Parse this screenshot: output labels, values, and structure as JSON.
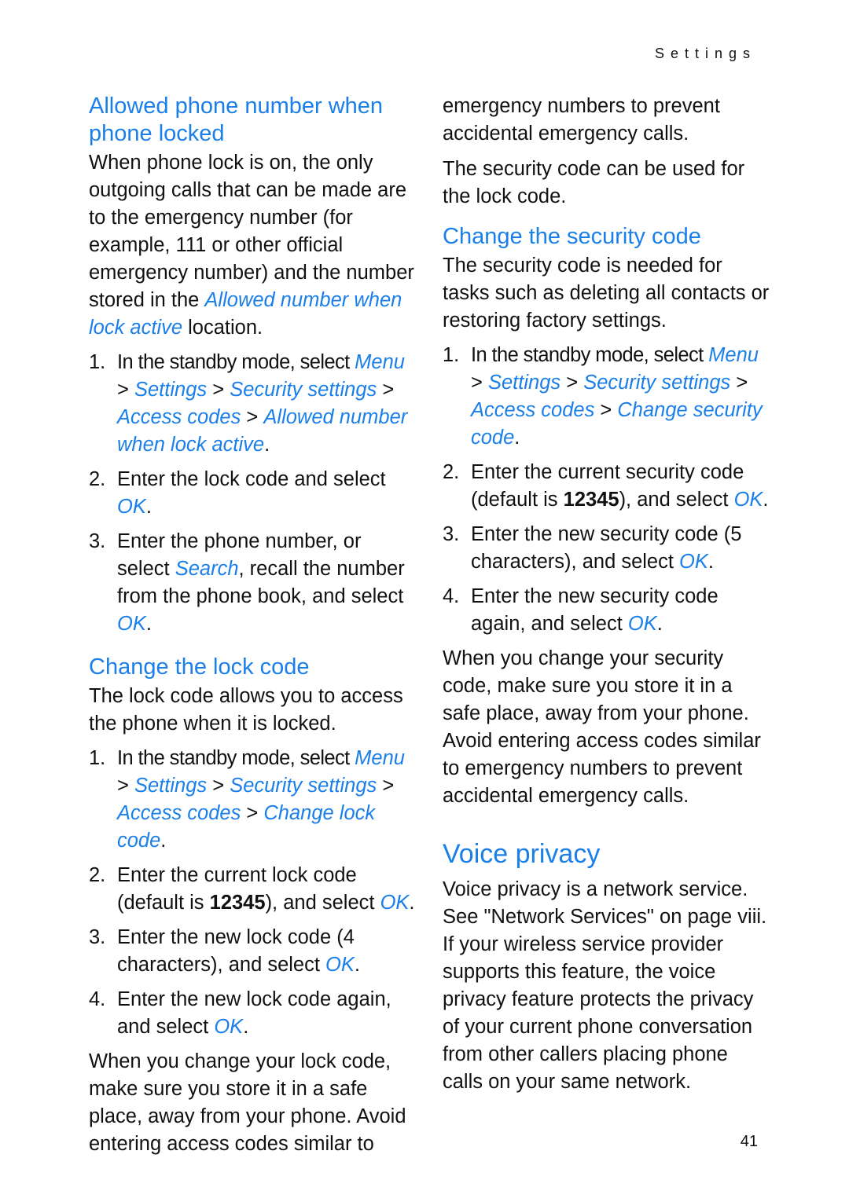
{
  "header": {
    "running_title": "Settings"
  },
  "left": {
    "sec1": {
      "heading": "Allowed phone number when phone locked",
      "para_a": "When phone lock is on, the only outgoing calls that can be made are to the emergency number (for example, 111 or other official emergency number) and the number stored in the ",
      "para_link": "Allowed number when lock active",
      "para_b": " location.",
      "steps": [
        {
          "num": "1.",
          "t1": "In the standby mode, select ",
          "l1": "Menu",
          "s1": " > ",
          "l2": "Settings",
          "s2": " > ",
          "l3": "Security settings",
          "s3": " > ",
          "l4": "Access codes",
          "s4": " > ",
          "l5": "Allowed number when lock active",
          "end": "."
        },
        {
          "num": "2.",
          "t1": "Enter the lock code and select ",
          "l1": "OK",
          "end": "."
        },
        {
          "num": "3.",
          "t1": "Enter the phone number, or select ",
          "l1": "Search",
          "t2": ", recall the number from the phone book, and select ",
          "l2": "OK",
          "end": "."
        }
      ]
    },
    "sec2": {
      "heading": "Change the lock code",
      "intro": "The lock code allows you to access the phone when it is locked.",
      "steps": [
        {
          "num": "1.",
          "t1": "In the standby mode, select ",
          "l1": "Menu",
          "s1": " > ",
          "l2": "Settings",
          "s2": " > ",
          "l3": "Security settings",
          "s3": " > ",
          "l4": "Access codes",
          "s4": " > ",
          "l5": "Change lock code",
          "end": "."
        },
        {
          "num": "2.",
          "t1": "Enter the current lock code (default is ",
          "b1": "12345",
          "t2": "), and select ",
          "l1": "OK",
          "end": "."
        },
        {
          "num": "3.",
          "t1": "Enter the new lock code (4 characters), and select ",
          "l1": "OK",
          "end": "."
        },
        {
          "num": "4.",
          "t1": "Enter the new lock code again, and select ",
          "l1": "OK",
          "end": "."
        }
      ],
      "note": "When you change your lock code, make sure you store it in a safe place, away from your phone. Avoid entering access codes similar to"
    }
  },
  "right": {
    "cont": "emergency numbers to prevent accidental emergency calls.",
    "para2": "The security code can be used for the lock code.",
    "sec3": {
      "heading": "Change the security code",
      "intro": "The security code is needed for tasks such as deleting all contacts or restoring factory settings.",
      "steps": [
        {
          "num": "1.",
          "t1": "In the standby mode, select ",
          "l1": "Menu",
          "s1": " > ",
          "l2": "Settings",
          "s2": " > ",
          "l3": "Security settings",
          "s3": " > ",
          "l4": "Access codes",
          "s4": " > ",
          "l5": "Change security code",
          "end": "."
        },
        {
          "num": "2.",
          "t1": "Enter the current security code (default is ",
          "b1": "12345",
          "t2": "), and select ",
          "l1": "OK",
          "end": "."
        },
        {
          "num": "3.",
          "t1": "Enter the new security code (5 characters), and select ",
          "l1": "OK",
          "end": "."
        },
        {
          "num": "4.",
          "t1": "Enter the new security code again, and select ",
          "l1": "OK",
          "end": "."
        }
      ],
      "note": "When you change your security code, make sure you store it in a safe place, away from your phone. Avoid entering access codes similar to emergency numbers to prevent accidental emergency calls."
    },
    "sec4": {
      "heading": "Voice privacy",
      "body": "Voice privacy is a network service. See \"Network Services\" on page viii. If your wireless service provider supports this feature, the voice privacy feature protects the privacy of your current phone conversation from other callers placing phone calls on your same network."
    }
  },
  "footer": {
    "page_number": "41"
  },
  "colors": {
    "accent": "#1a7fe8",
    "text": "#111111"
  }
}
